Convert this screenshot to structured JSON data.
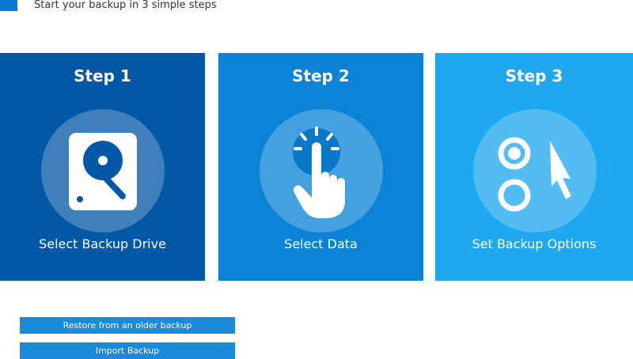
{
  "header": {
    "subtitle": "Start your backup in 3 simple steps"
  },
  "steps": [
    {
      "title": "Step 1",
      "label": "Select Backup Drive",
      "icon": "hard-drive-icon",
      "color": "#0358a5"
    },
    {
      "title": "Step 2",
      "label": "Select Data",
      "icon": "hand-pointer-tap-icon",
      "color": "#0a83d6"
    },
    {
      "title": "Step 3",
      "label": "Set Backup Options",
      "icon": "options-cursor-icon",
      "color": "#1ea8ef"
    }
  ],
  "buttons": {
    "restore_label": "Restore from an older backup",
    "import_label": "Import Backup",
    "color": "#1b8ad8"
  }
}
